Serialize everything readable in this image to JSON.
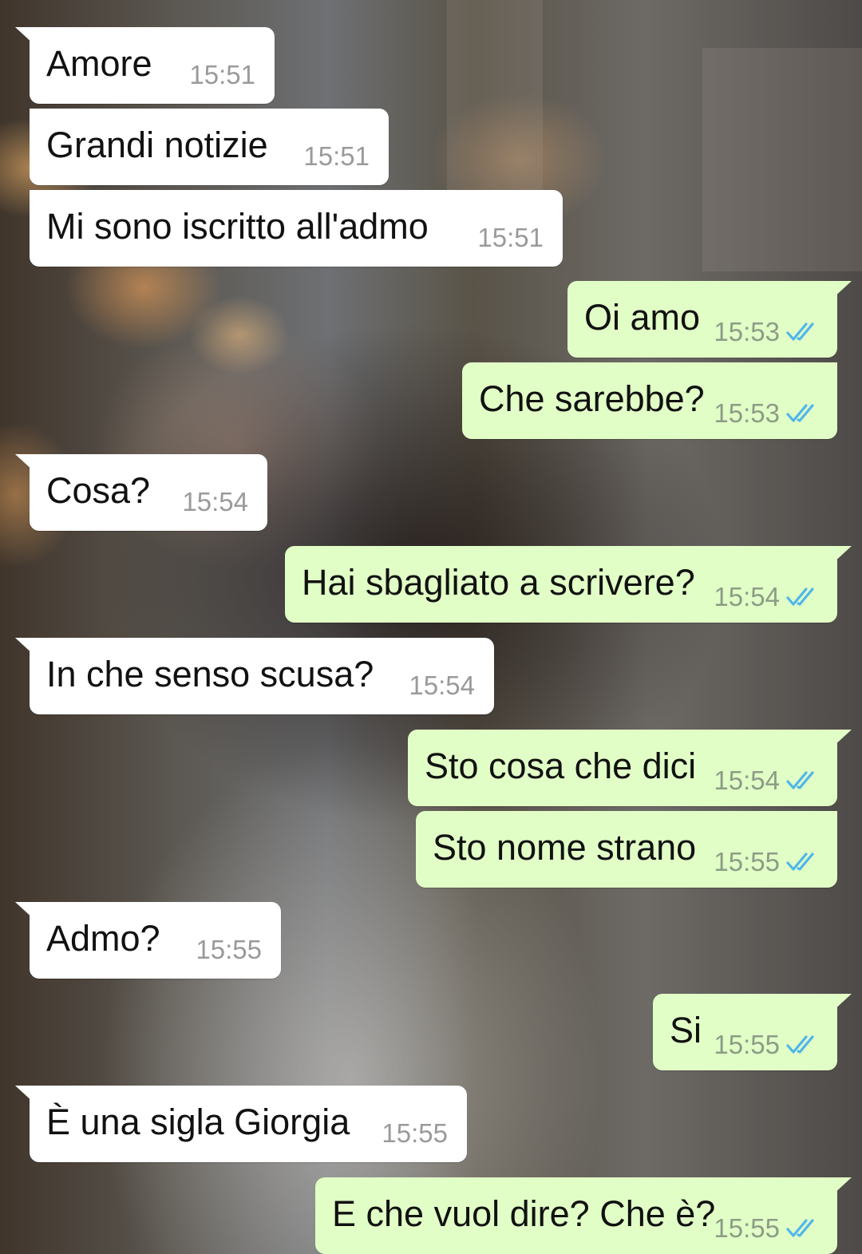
{
  "colors": {
    "incoming_bubble": "#ffffff",
    "outgoing_bubble": "#e1fec6",
    "read_tick": "#4fb6ec"
  },
  "messages": [
    {
      "direction": "in",
      "text": "Amore",
      "time": "15:51"
    },
    {
      "direction": "in",
      "text": "Grandi notizie",
      "time": "15:51"
    },
    {
      "direction": "in",
      "text": "Mi sono iscritto all'admo",
      "time": "15:51"
    },
    {
      "direction": "out",
      "text": "Oi amo",
      "time": "15:53",
      "status": "read"
    },
    {
      "direction": "out",
      "text": "Che sarebbe?",
      "time": "15:53",
      "status": "read"
    },
    {
      "direction": "in",
      "text": "Cosa?",
      "time": "15:54"
    },
    {
      "direction": "out",
      "text": "Hai sbagliato a scrivere?",
      "time": "15:54",
      "status": "read"
    },
    {
      "direction": "in",
      "text": "In che senso scusa?",
      "time": "15:54"
    },
    {
      "direction": "out",
      "text": "Sto cosa che dici",
      "time": "15:54",
      "status": "read"
    },
    {
      "direction": "out",
      "text": "Sto nome strano",
      "time": "15:55",
      "status": "read"
    },
    {
      "direction": "in",
      "text": "Admo?",
      "time": "15:55"
    },
    {
      "direction": "out",
      "text": "Si",
      "time": "15:55",
      "status": "read"
    },
    {
      "direction": "in",
      "text": "È una sigla Giorgia",
      "time": "15:55"
    },
    {
      "direction": "out",
      "text": "E che vuol dire? Che è?",
      "time": "15:55",
      "status": "read"
    }
  ]
}
